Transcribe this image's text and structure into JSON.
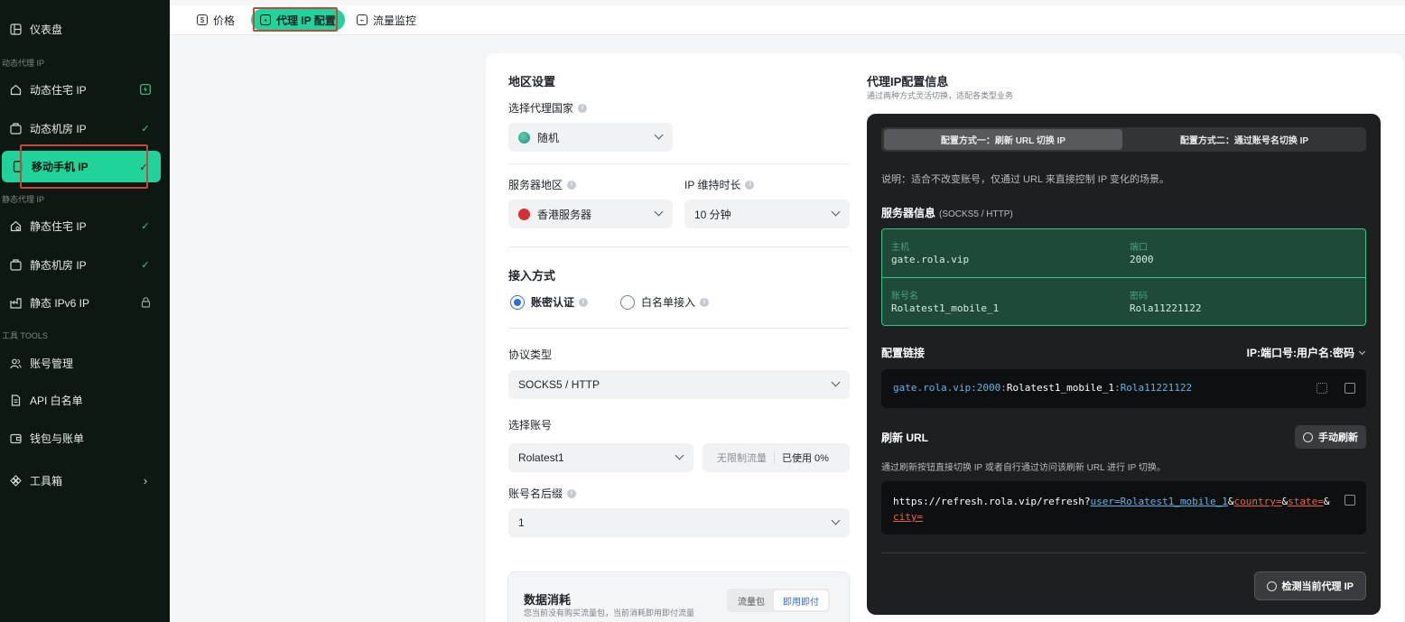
{
  "sidebar": {
    "dashboard": "仪表盘",
    "section_dynamic": "动态代理 IP",
    "dynamic_residential": "动态住宅 IP",
    "dynamic_datacenter": "动态机房 IP",
    "mobile": "移动手机 IP",
    "section_static": "静态代理 IP",
    "static_residential": "静态住宅 IP",
    "static_datacenter": "静态机房 IP",
    "static_ipv6": "静态 IPv6 IP",
    "section_tools": "工具 TOOLS",
    "account_mgmt": "账号管理",
    "api_whitelist": "API 白名单",
    "wallet": "钱包与账单",
    "toolbox": "工具箱"
  },
  "tabs": {
    "price": "价格",
    "config": "代理 IP 配置",
    "traffic": "流量监控"
  },
  "region": {
    "title": "地区设置",
    "country_label": "选择代理国家",
    "country_value": "随机",
    "server_label": "服务器地区",
    "server_value": "香港服务器",
    "duration_label": "IP 维持时长",
    "duration_value": "10 分钟"
  },
  "access": {
    "title": "接入方式",
    "option_password": "账密认证",
    "option_whitelist": "白名单接入",
    "protocol_label": "协议类型",
    "protocol_value": "SOCKS5 / HTTP",
    "account_label": "选择账号",
    "account_value": "Rolatest1",
    "usage_limit": "无限制流量",
    "usage_used": "已使用 0%",
    "suffix_label": "账号名后缀",
    "suffix_value": "1"
  },
  "consume": {
    "title": "数据消耗",
    "subtitle": "您当前没有购买流量包，当前消耗即用即付流量",
    "seg_package": "流量包",
    "seg_payg": "即用即付"
  },
  "panel": {
    "title": "代理IP配置信息",
    "subtitle": "通过两种方式灵活切换，适配各类型业务",
    "mode1": "配置方式一：刷新 URL 切换 IP",
    "mode2": "配置方式二：通过账号名切换 IP",
    "note": "说明：适合不改变账号，仅通过 URL 来直接控制 IP 变化的场景。",
    "server_info": "服务器信息",
    "server_info_sub": "(SOCKS5 / HTTP)",
    "host_label": "主机",
    "host_value": "gate.rola.vip",
    "port_label": "端口",
    "port_value": "2000",
    "user_label": "账号名",
    "user_value": "Rolatest1_mobile_1",
    "pass_label": "密码",
    "pass_value": "Rola11221122",
    "link_title": "配置链接",
    "link_format": "IP:端口号:用户名:密码",
    "link_host_port": "gate.rola.vip:2000:",
    "link_user": "Rolatest1_mobile_1",
    "link_colon": ":",
    "link_pass": "Rola11221122",
    "refresh_title": "刷新 URL",
    "refresh_button": "手动刷新",
    "refresh_note": "通过刷新按钮直接切换 IP 或者自行通过访问该刷新 URL 进行 IP 切换。",
    "url_base": "https://refresh.rola.vip/refresh?",
    "url_user": "user=Rolatest1_mobile_1",
    "url_amp1": "&",
    "url_country": "country=",
    "url_amp2": "&",
    "url_state": "state=",
    "url_amp3": "&",
    "url_city": "city=",
    "check_button": "检测当前代理 IP"
  }
}
